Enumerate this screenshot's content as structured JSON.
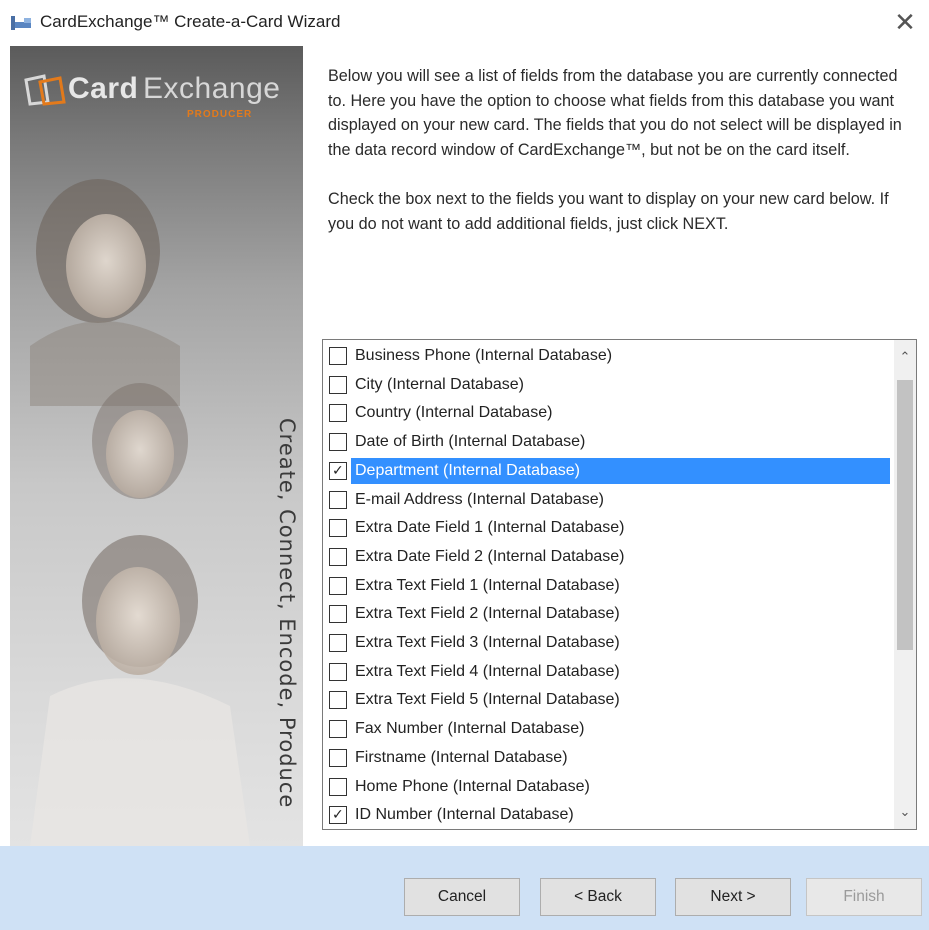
{
  "window": {
    "title": "CardExchange™ Create-a-Card Wizard",
    "close_label": "✕"
  },
  "banner": {
    "logo_card": "Card",
    "logo_exchange": "Exchange",
    "logo_producer": "PRODUCER",
    "tagline": "Create, Connect, Encode, Produce"
  },
  "instructions": {
    "paragraph1": "Below you will see a list of fields from the database you are currently connected to. Here you have the option to choose what fields from this database you want displayed on your new card. The fields that you do not select will be displayed in the data record window of CardExchange™, but not be on the card itself.",
    "paragraph2": "Check the box next to the fields you want to display on your new card below. If you do not want to add additional fields, just click NEXT."
  },
  "fields": [
    {
      "label": "Business Phone (Internal Database)",
      "checked": false,
      "selected": false
    },
    {
      "label": "City (Internal Database)",
      "checked": false,
      "selected": false
    },
    {
      "label": "Country (Internal Database)",
      "checked": false,
      "selected": false
    },
    {
      "label": "Date of Birth (Internal Database)",
      "checked": false,
      "selected": false
    },
    {
      "label": "Department (Internal Database)",
      "checked": true,
      "selected": true
    },
    {
      "label": "E-mail Address (Internal Database)",
      "checked": false,
      "selected": false
    },
    {
      "label": "Extra Date Field 1 (Internal Database)",
      "checked": false,
      "selected": false
    },
    {
      "label": "Extra Date Field 2 (Internal Database)",
      "checked": false,
      "selected": false
    },
    {
      "label": "Extra Text Field 1 (Internal Database)",
      "checked": false,
      "selected": false
    },
    {
      "label": "Extra Text Field 2 (Internal Database)",
      "checked": false,
      "selected": false
    },
    {
      "label": "Extra Text Field 3 (Internal Database)",
      "checked": false,
      "selected": false
    },
    {
      "label": "Extra Text Field 4 (Internal Database)",
      "checked": false,
      "selected": false
    },
    {
      "label": "Extra Text Field 5 (Internal Database)",
      "checked": false,
      "selected": false
    },
    {
      "label": "Fax Number (Internal Database)",
      "checked": false,
      "selected": false
    },
    {
      "label": "Firstname (Internal Database)",
      "checked": false,
      "selected": false
    },
    {
      "label": "Home Phone (Internal Database)",
      "checked": false,
      "selected": false
    },
    {
      "label": "ID Number (Internal Database)",
      "checked": true,
      "selected": false
    }
  ],
  "scrollbar": {
    "up_arrow": "⌃",
    "down_arrow": "⌄"
  },
  "buttons": {
    "cancel": "Cancel",
    "back": "< Back",
    "next": "Next >",
    "finish": "Finish"
  },
  "colors": {
    "selection": "#3390ff",
    "footer": "#cfe1f5",
    "accent_orange": "#e37a1b"
  }
}
